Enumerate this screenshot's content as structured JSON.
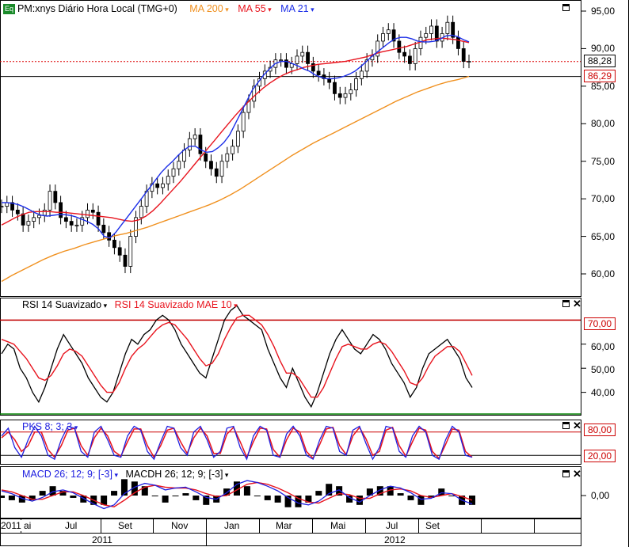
{
  "header": {
    "eq_badge": "Eq",
    "symbol": "PM:xnys Diário Hora Local (TMG+0)",
    "ma200": "MA 200",
    "ma55": "MA 55",
    "ma21": "MA 21",
    "arrow": "▾"
  },
  "colors": {
    "ma200": "#f0901e",
    "ma55": "#e8141e",
    "ma21": "#1c2ee8",
    "price": "#000000",
    "rsi": "#000000",
    "rsi_ema": "#e8141e",
    "pks_k": "#2020e0",
    "pks_d": "#e8141e",
    "macd": "#2020e0",
    "macd_signal": "#e8141e",
    "overbought_line": "#c00000",
    "oversold_line": "#008000"
  },
  "price_panel": {
    "y_ticks": [
      "95,00",
      "90,00",
      "85,00",
      "80,00",
      "75,00",
      "70,00",
      "65,00",
      "60,00"
    ],
    "last_price_tag": "88,28",
    "ma_tag": "86,29"
  },
  "rsi_panel": {
    "title": "RSI 14 Suavizado",
    "overlay_title": "RSI 14 Suavizado MAE 10",
    "y_ticks": [
      "60,00",
      "50,00",
      "40,00"
    ],
    "overbought_tag": "70,00"
  },
  "pks_panel": {
    "title": "PKS 8; 3; 3",
    "upper_tag": "80,00",
    "lower_tag": "20,00"
  },
  "macd_panel": {
    "title": "MACD 26; 12; 9; [-3]",
    "hist_title": "MACDH 26; 12; 9; [-3]",
    "y_tick": "0,00"
  },
  "x_axis": {
    "months": [
      "2011",
      "ai",
      "Jul",
      "Set",
      "Nov",
      "Jan",
      "Mar",
      "Mai",
      "Jul",
      "Set"
    ],
    "years": [
      "2011",
      "2012"
    ]
  },
  "chart_data": {
    "type": "line",
    "title": "PM:xnys Diário Hora Local (TMG+0)",
    "x_range": [
      "2011-05",
      "2012-10"
    ],
    "price": {
      "ylim": [
        57.5,
        96
      ],
      "close": [
        69,
        69.5,
        68.5,
        68,
        66.5,
        67,
        67.5,
        67.8,
        68.5,
        71,
        69.5,
        67.5,
        67,
        66.5,
        66.5,
        67.5,
        68.5,
        68.2,
        66.5,
        65.5,
        64.5,
        63.5,
        62.5,
        61,
        65,
        67.5,
        69,
        71,
        72,
        71.5,
        72,
        73,
        74,
        75,
        76.5,
        78,
        78.5,
        76,
        75,
        74,
        73,
        75,
        76,
        77,
        79,
        81.5,
        83,
        85,
        86,
        87,
        87.5,
        88.5,
        88.5,
        87.5,
        88,
        89,
        89.5,
        88,
        87,
        86.5,
        86,
        85.5,
        84,
        83.5,
        84,
        84.5,
        86,
        87,
        88.5,
        89,
        91,
        92,
        92.5,
        91,
        89.5,
        89,
        88,
        90,
        91.5,
        92,
        93,
        91,
        92,
        93.5,
        91.5,
        90,
        88.3,
        88.3
      ],
      "ma21": [
        69.5,
        69.5,
        69.4,
        69.2,
        68.9,
        68.5,
        68.1,
        67.8,
        67.7,
        67.8,
        67.9,
        67.9,
        67.8,
        67.6,
        67.3,
        67,
        66.6,
        66,
        65,
        64.8,
        65.5,
        66.5,
        67.5,
        68.5,
        69.5,
        70.5,
        71.5,
        72.5,
        73.5,
        74.3,
        75,
        75.8,
        76.5,
        77,
        77,
        76.5,
        76.2,
        76.3,
        76.8,
        77.5,
        78.5,
        80,
        81.5,
        83,
        84.5,
        85.5,
        86.5,
        87.3,
        88,
        88.3,
        88.3,
        88,
        87.7,
        87.3,
        87,
        86.5,
        86.2,
        86,
        86,
        86.1,
        86.3,
        86.6,
        87,
        87.6,
        88.3,
        89,
        89.6,
        90.2,
        90.8,
        91.3,
        91.5,
        91.5,
        91.3,
        91,
        90.9,
        90.9,
        91,
        91.3,
        91.7,
        91.8,
        91.6,
        91.2,
        90.9
      ],
      "ma55": [
        66.5,
        67,
        67.5,
        67.9,
        68.2,
        68.3,
        68.3,
        68.3,
        68.2,
        68.2,
        68.1,
        68,
        67.9,
        67.8,
        67.7,
        67.6,
        67.5,
        67.3,
        67.1,
        67,
        67.2,
        67.7,
        68.4,
        69.3,
        70.3,
        71.3,
        72.3,
        73.4,
        74.5,
        75.6,
        76.7,
        77.8,
        78.9,
        80,
        81.1,
        82.1,
        83,
        83.9,
        84.7,
        85.4,
        86,
        86.5,
        86.9,
        87.2,
        87.5,
        87.7,
        87.9,
        88,
        88.1,
        88.2,
        88.3,
        88.5,
        88.7,
        88.9,
        89.2,
        89.5,
        89.7,
        89.9,
        90.1,
        90.3,
        90.6,
        90.9,
        91.2,
        91.3,
        91.4,
        91.3,
        91.2,
        91,
        90.8
      ],
      "ma200": [
        59,
        59.8,
        60.5,
        61.2,
        61.9,
        62.5,
        63,
        63.4,
        63.9,
        64.3,
        64.7,
        65.1,
        65.4,
        65.8,
        66.2,
        66.7,
        67.2,
        67.7,
        68.2,
        68.7,
        69.2,
        69.8,
        70.5,
        71.3,
        72.2,
        73.1,
        74,
        74.9,
        75.8,
        76.6,
        77.4,
        78.1,
        78.8,
        79.5,
        80.2,
        80.9,
        81.6,
        82.3,
        83,
        83.6,
        84.2,
        84.7,
        85.2,
        85.6,
        85.9,
        86.3
      ]
    },
    "rsi": {
      "ylim": [
        31,
        78
      ],
      "overbought": 70,
      "values": [
        56,
        60,
        58,
        50,
        46,
        40,
        36,
        42,
        50,
        58,
        64,
        60,
        56,
        52,
        46,
        42,
        38,
        36,
        40,
        48,
        56,
        62,
        60,
        64,
        66,
        70,
        72,
        70,
        66,
        60,
        56,
        52,
        48,
        46,
        54,
        62,
        70,
        74,
        76,
        72,
        70,
        68,
        66,
        58,
        52,
        46,
        42,
        50,
        44,
        38,
        34,
        40,
        48,
        56,
        62,
        66,
        62,
        58,
        56,
        60,
        64,
        62,
        58,
        52,
        48,
        44,
        38,
        42,
        50,
        56,
        58,
        60,
        62,
        58,
        54,
        46,
        42
      ],
      "ema": [
        62,
        61,
        60,
        57,
        54,
        50,
        46,
        45,
        47,
        51,
        56,
        58,
        57,
        55,
        51,
        47,
        43,
        40,
        40,
        44,
        50,
        55,
        58,
        60,
        63,
        66,
        68,
        69,
        68,
        65,
        62,
        58,
        54,
        51,
        52,
        56,
        62,
        67,
        71,
        72,
        72,
        70,
        68,
        64,
        59,
        53,
        48,
        48,
        46,
        42,
        38,
        38,
        42,
        48,
        54,
        59,
        60,
        59,
        58,
        58,
        60,
        61,
        60,
        57,
        53,
        49,
        44,
        43,
        46,
        51,
        55,
        57,
        59,
        59,
        57,
        52,
        47
      ]
    },
    "pks": {
      "ylim": [
        0,
        100
      ],
      "upper": 80,
      "lower": 20,
      "k": [
        70,
        90,
        40,
        15,
        60,
        95,
        70,
        20,
        10,
        60,
        95,
        90,
        30,
        15,
        80,
        95,
        60,
        20,
        15,
        70,
        95,
        85,
        30,
        10,
        55,
        95,
        90,
        40,
        20,
        80,
        95,
        60,
        15,
        30,
        90,
        95,
        40,
        10,
        70,
        95,
        85,
        20,
        15,
        75,
        95,
        70,
        20,
        10,
        60,
        95,
        90,
        30,
        20,
        85,
        95,
        50,
        10,
        40,
        95,
        90,
        30,
        15,
        70,
        95,
        80,
        20,
        10,
        60,
        95,
        80,
        20,
        15
      ],
      "d": [
        65,
        80,
        60,
        30,
        45,
        80,
        80,
        35,
        15,
        45,
        85,
        90,
        45,
        20,
        65,
        90,
        70,
        30,
        18,
        55,
        88,
        88,
        45,
        15,
        45,
        85,
        90,
        55,
        25,
        65,
        90,
        70,
        25,
        25,
        75,
        92,
        55,
        15,
        55,
        90,
        88,
        35,
        15,
        60,
        90,
        80,
        30,
        12,
        48,
        88,
        92,
        45,
        22,
        70,
        92,
        62,
        20,
        30,
        85,
        92,
        45,
        18,
        55,
        90,
        85,
        30,
        12,
        48,
        88,
        85,
        30,
        15
      ]
    },
    "macd": {
      "macd": [
        0.5,
        0.2,
        -0.3,
        -0.6,
        -0.2,
        0.4,
        0.6,
        0.3,
        -0.3,
        -0.9,
        -1.4,
        -1.0,
        0.2,
        0.9,
        1.3,
        1.1,
        0.6,
        0.8,
        0.9,
        0.4,
        -0.2,
        -0.4,
        0.3,
        1.2,
        1.6,
        1.4,
        1.0,
        0.5,
        -0.2,
        -0.8,
        -1.0,
        -0.6,
        0.2,
        0.6,
        -0.2,
        -0.7,
        0.0,
        0.6,
        1.0,
        0.8,
        0.3,
        -0.4,
        -0.3,
        0.3,
        0.2,
        -0.5,
        -0.9
      ],
      "signal": [
        0.6,
        0.4,
        0.0,
        -0.4,
        -0.4,
        0.0,
        0.4,
        0.4,
        0.0,
        -0.5,
        -1.0,
        -1.2,
        -0.5,
        0.3,
        0.9,
        1.1,
        0.9,
        0.8,
        0.8,
        0.6,
        0.2,
        -0.1,
        0.0,
        0.6,
        1.2,
        1.4,
        1.2,
        0.8,
        0.3,
        -0.3,
        -0.7,
        -0.8,
        -0.3,
        0.2,
        0.1,
        -0.3,
        -0.3,
        0.2,
        0.6,
        0.7,
        0.5,
        0.0,
        -0.2,
        0.0,
        0.2,
        -0.1,
        -0.5
      ],
      "ylim": [
        -2.2,
        2.2
      ]
    }
  }
}
